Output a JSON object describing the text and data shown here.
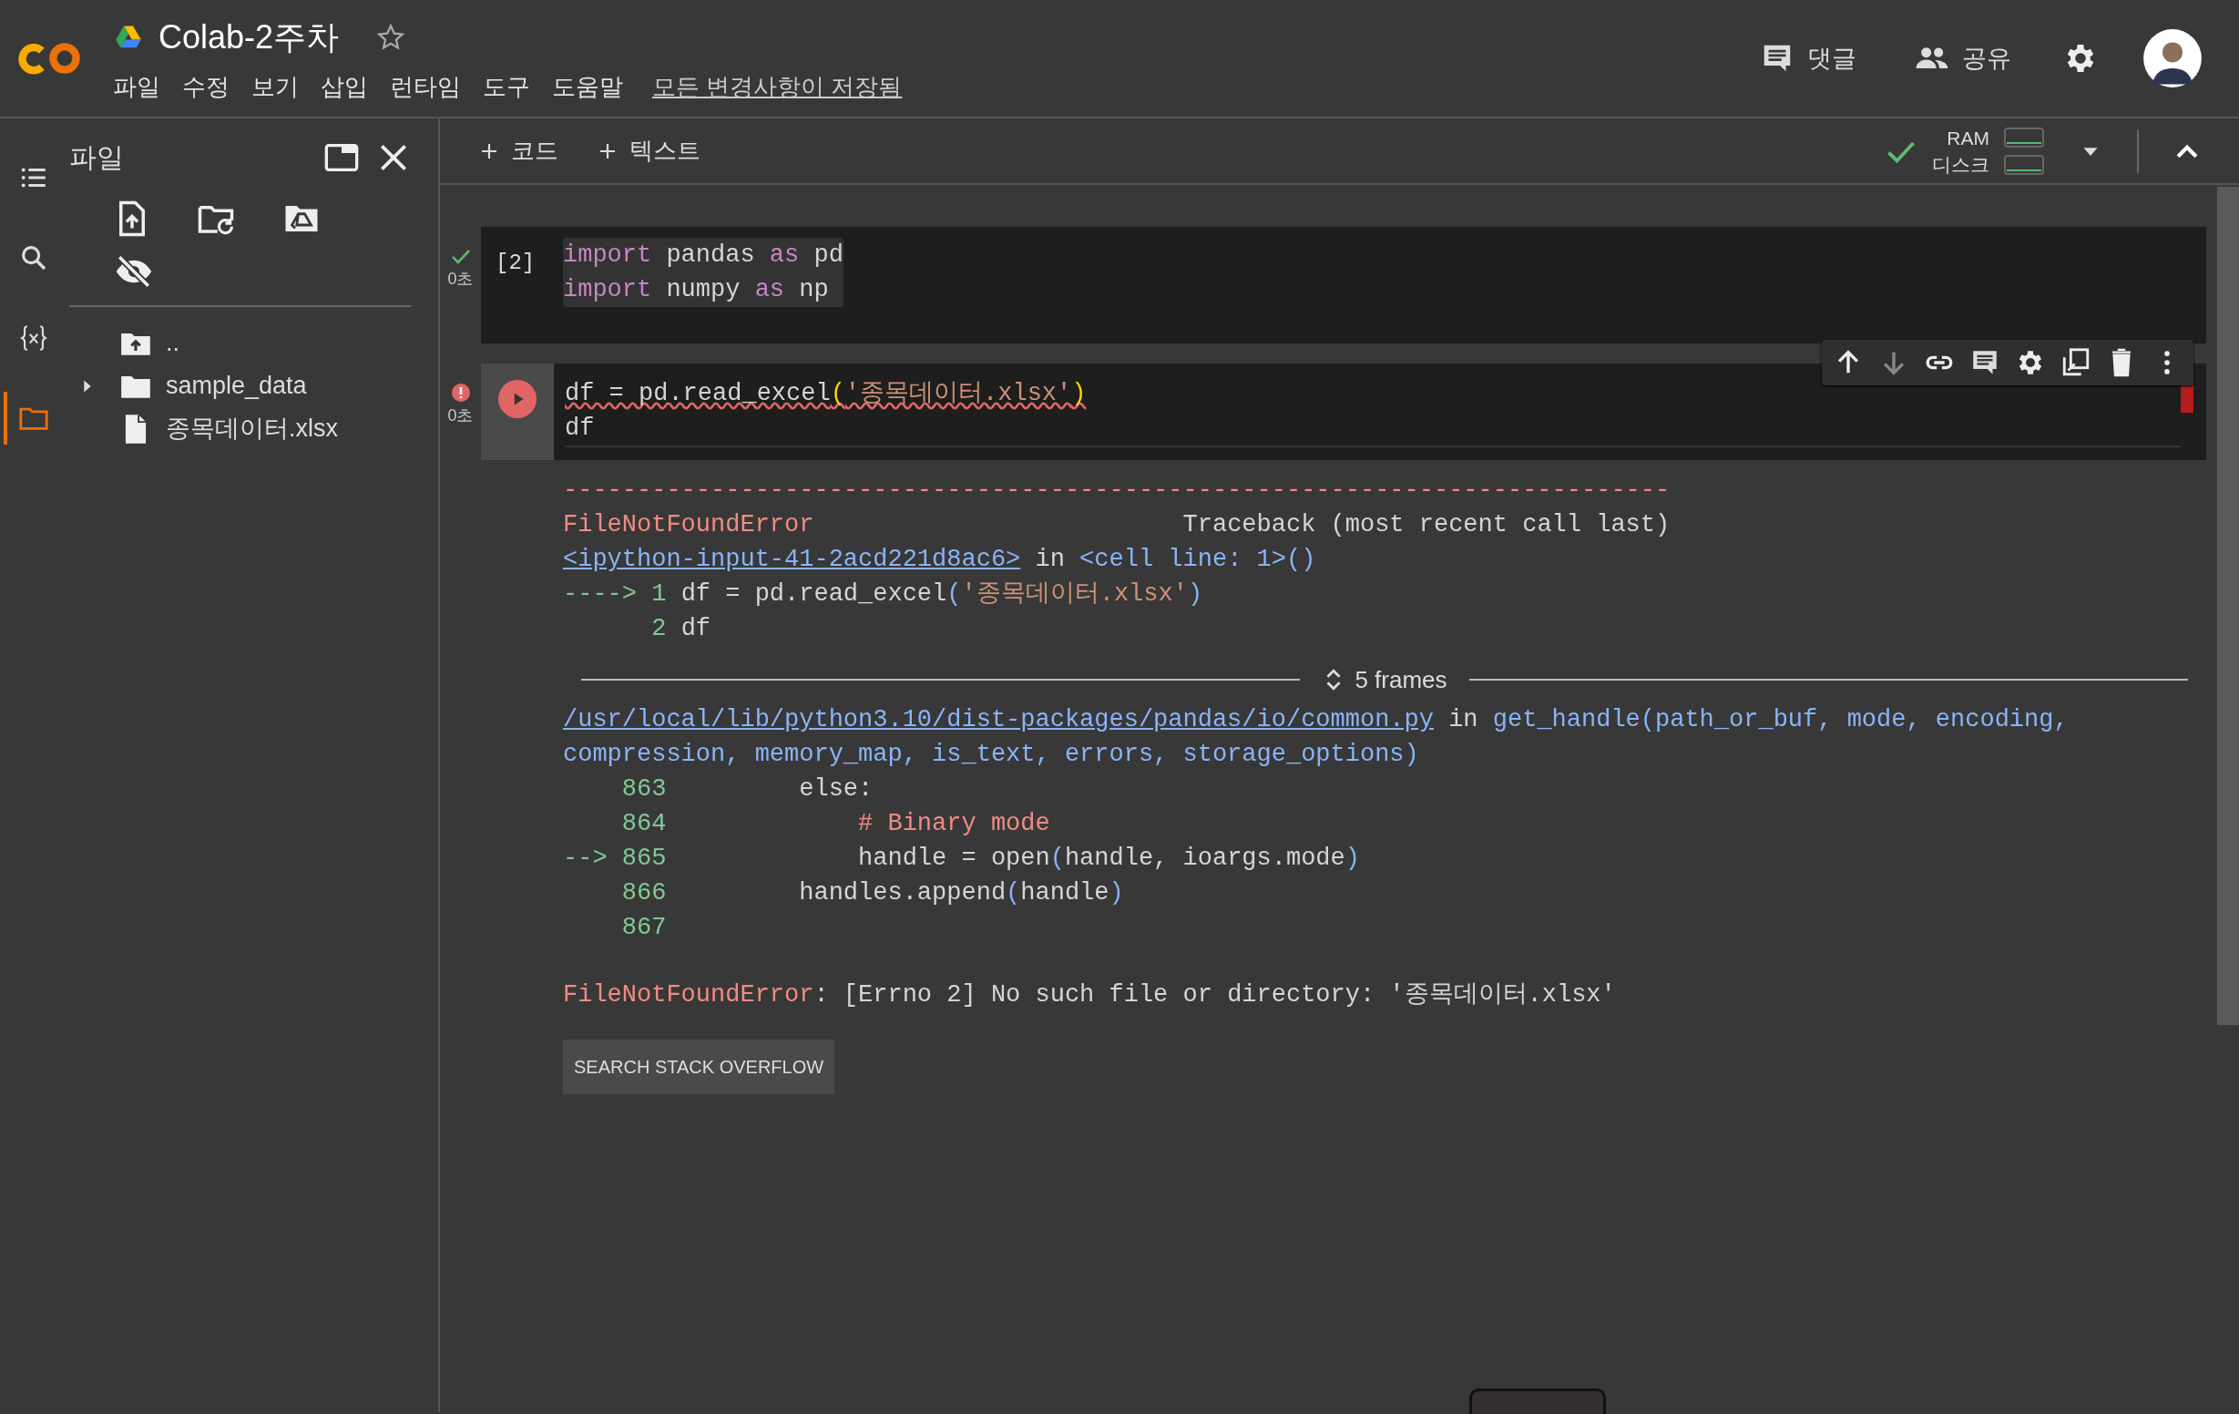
{
  "header": {
    "title": "Colab-2주차",
    "starred": false,
    "menu": [
      "파일",
      "수정",
      "보기",
      "삽입",
      "런타임",
      "도구",
      "도움말"
    ],
    "save_status": "모든 변경사항이 저장됨",
    "actions": [
      {
        "kind": "comment",
        "label": "댓글"
      },
      {
        "kind": "share",
        "label": "공유"
      }
    ]
  },
  "rail": [
    {
      "kind": "toc",
      "selected": false
    },
    {
      "kind": "search",
      "selected": false
    },
    {
      "kind": "variables",
      "selected": false
    },
    {
      "kind": "files",
      "selected": true
    }
  ],
  "sidebar": {
    "title": "파일",
    "tree": [
      {
        "kind": "parent",
        "name": ".."
      },
      {
        "kind": "folder",
        "name": "sample_data",
        "expanded": false
      },
      {
        "kind": "file",
        "name": "종목데이터.xlsx"
      }
    ]
  },
  "toolbar": {
    "add": [
      "코드",
      "텍스트"
    ],
    "connected": true,
    "resources": [
      "RAM",
      "디스크"
    ]
  },
  "cells": [
    {
      "kind": "success",
      "count": "[2]",
      "time": "0초",
      "focused": false,
      "lines": [
        [
          {
            "kind": "keyword",
            "text": "import"
          },
          {
            "kind": "plain",
            "text": " pandas "
          },
          {
            "kind": "keyword",
            "text": "as"
          },
          {
            "kind": "plain",
            "text": " pd"
          }
        ],
        [
          {
            "kind": "keyword",
            "text": "import"
          },
          {
            "kind": "plain",
            "text": " numpy "
          },
          {
            "kind": "keyword",
            "text": "as"
          },
          {
            "kind": "plain",
            "text": " np"
          }
        ]
      ]
    },
    {
      "kind": "error",
      "time": "0초",
      "focused": true,
      "lines": [
        [
          {
            "kind": "plain",
            "text": "df = pd.read_excel"
          },
          {
            "kind": "bracket",
            "text": "("
          },
          {
            "kind": "string",
            "text": "'종목데이터.xlsx'"
          },
          {
            "kind": "bracket",
            "text": ")"
          }
        ],
        [
          {
            "kind": "plain",
            "text": "df"
          }
        ]
      ],
      "output": {
        "lines": [
          [
            {
              "kind": "error",
              "text": "---------------------------------------------------------------------------"
            }
          ],
          [
            {
              "kind": "error",
              "text": "FileNotFoundError"
            },
            {
              "kind": "plain",
              "text": "                         Traceback (most recent call last)"
            }
          ],
          [
            {
              "kind": "link",
              "text": "<ipython-input-41-2acd221d8ac6>"
            },
            {
              "kind": "plain",
              "text": " in "
            },
            {
              "kind": "name",
              "text": "<cell line: 1>()"
            }
          ],
          [
            {
              "kind": "lineno",
              "text": "----> 1 "
            },
            {
              "kind": "plain",
              "text": "df = pd.read_excel"
            },
            {
              "kind": "name",
              "text": "("
            },
            {
              "kind": "string",
              "text": "'종목데이터.xlsx'"
            },
            {
              "kind": "name",
              "text": ")"
            }
          ],
          [
            {
              "kind": "lineno",
              "text": "      2 "
            },
            {
              "kind": "plain",
              "text": "df"
            }
          ]
        ],
        "frames_label": "5 frames",
        "lines2": [
          [
            {
              "kind": "link",
              "text": "/usr/local/lib/python3.10/dist-packages/pandas/io/common.py"
            },
            {
              "kind": "plain",
              "text": " in "
            },
            {
              "kind": "name",
              "text": "get_handle(path_or_buf, mode, encoding,"
            }
          ],
          [
            {
              "kind": "name",
              "text": "compression, memory_map, is_text, errors, storage_options)"
            }
          ],
          [
            {
              "kind": "lineno",
              "text": "    863 "
            },
            {
              "kind": "plain",
              "text": "        else:"
            }
          ],
          [
            {
              "kind": "lineno",
              "text": "    864 "
            },
            {
              "kind": "error",
              "text": "            # Binary mode"
            }
          ],
          [
            {
              "kind": "lineno",
              "text": "--> 865 "
            },
            {
              "kind": "plain",
              "text": "            handle = open"
            },
            {
              "kind": "name",
              "text": "("
            },
            {
              "kind": "plain",
              "text": "handle, ioargs.mode"
            },
            {
              "kind": "name",
              "text": ")"
            }
          ],
          [
            {
              "kind": "lineno",
              "text": "    866 "
            },
            {
              "kind": "plain",
              "text": "        handles.append"
            },
            {
              "kind": "name",
              "text": "("
            },
            {
              "kind": "plain",
              "text": "handle"
            },
            {
              "kind": "name",
              "text": ")"
            }
          ],
          [
            {
              "kind": "lineno",
              "text": "    867 "
            }
          ]
        ],
        "error_line": [
          {
            "kind": "error",
            "text": "FileNotFoundError"
          },
          {
            "kind": "plain",
            "text": ": [Errno 2] No such file or directory: '종목데이터.xlsx'"
          }
        ],
        "button": "SEARCH STACK OVERFLOW"
      }
    }
  ]
}
